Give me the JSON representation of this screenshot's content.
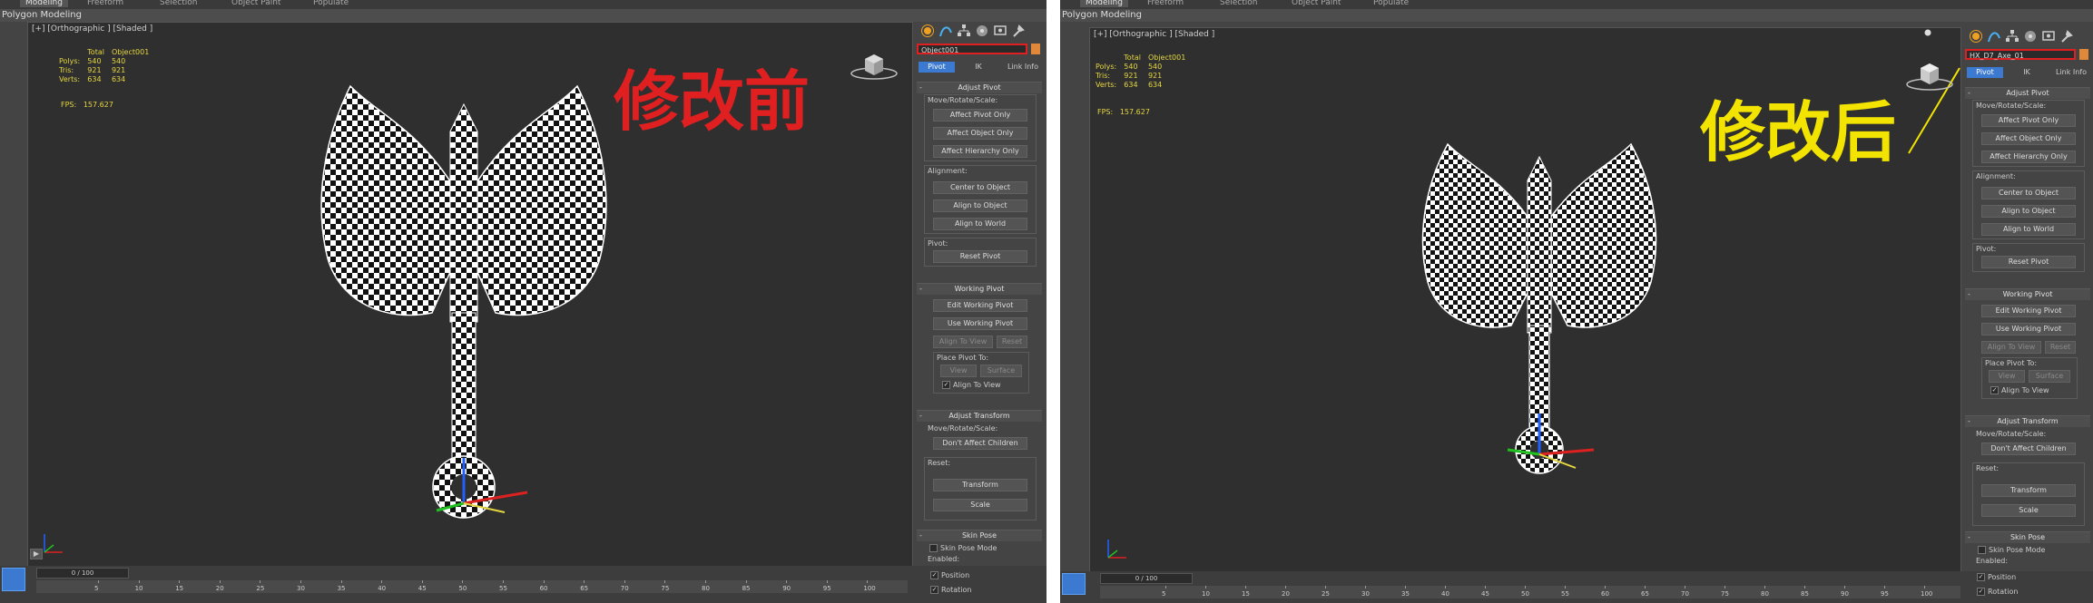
{
  "colors": {
    "accent_blue": "#3b7ad0",
    "highlight_red": "#e02020",
    "stats_yellow": "#e5d640",
    "before_text": "#e02020",
    "after_text": "#f2e400",
    "swatch_orange": "#e0883a"
  },
  "left": {
    "ribbon_tabs": [
      "Modeling",
      "Freeform",
      "Selection",
      "Object Paint",
      "Populate"
    ],
    "subtitle": "Polygon Modeling",
    "viewport_label": "[+] [Orthographic ] [Shaded ]",
    "stats": {
      "col_total": "Total",
      "col_object": "Object001",
      "rows": [
        {
          "label": "Polys:",
          "total": "540",
          "object": "540"
        },
        {
          "label": "Tris:",
          "total": "921",
          "object": "921"
        },
        {
          "label": "Verts:",
          "total": "634",
          "object": "634"
        }
      ]
    },
    "fps_label": "FPS:",
    "fps_value": "157.627",
    "annotation": "修改前",
    "object_name": "Object001",
    "time_slider": "0 / 100"
  },
  "right": {
    "ribbon_tabs": [
      "Modeling",
      "Freeform",
      "Selection",
      "Object Paint",
      "Populate"
    ],
    "subtitle": "Polygon Modeling",
    "viewport_label": "[+] [Orthographic ] [Shaded ]",
    "stats": {
      "col_total": "Total",
      "col_object": "Object001",
      "rows": [
        {
          "label": "Polys:",
          "total": "540",
          "object": "540"
        },
        {
          "label": "Tris:",
          "total": "921",
          "object": "921"
        },
        {
          "label": "Verts:",
          "total": "634",
          "object": "634"
        }
      ]
    },
    "fps_label": "FPS:",
    "fps_value": "157.627",
    "annotation": "修改后",
    "object_name": "HX_D7_Axe_01",
    "time_slider": "0 / 100"
  },
  "cmd": {
    "tabs": [
      "Pivot",
      "IK",
      "Link Info"
    ],
    "adjust_pivot": {
      "title": "Adjust Pivot",
      "move_label": "Move/Rotate/Scale:",
      "buttons": [
        "Affect Pivot Only",
        "Affect Object Only",
        "Affect Hierarchy Only"
      ],
      "alignment_label": "Alignment:",
      "align_buttons": [
        "Center to Object",
        "Align to Object",
        "Align to World"
      ],
      "pivot_label": "Pivot:",
      "reset_pivot": "Reset Pivot"
    },
    "working_pivot": {
      "title": "Working Pivot",
      "edit": "Edit Working Pivot",
      "use": "Use Working Pivot",
      "align_to_view": "Align To View",
      "reset": "Reset",
      "place_label": "Place Pivot To:",
      "view": "View",
      "surface": "Surface",
      "align_chk": "Align To View"
    },
    "adjust_transform": {
      "title": "Adjust Transform",
      "move_label": "Move/Rotate/Scale:",
      "dont_affect": "Don't Affect Children",
      "reset_label": "Reset:",
      "transform": "Transform",
      "scale": "Scale"
    },
    "skin_pose": {
      "title": "Skin Pose",
      "mode": "Skin Pose Mode",
      "enabled_label": "Enabled:",
      "position": "Position",
      "rotation": "Rotation"
    }
  },
  "ruler_ticks": [
    "5",
    "10",
    "15",
    "20",
    "25",
    "30",
    "35",
    "40",
    "45",
    "50",
    "55",
    "60",
    "65",
    "70",
    "75",
    "80",
    "85",
    "90",
    "95",
    "100"
  ],
  "icons": [
    "sun-icon",
    "curve-icon",
    "hierarchy-icon",
    "motion-icon",
    "display-icon",
    "utilities-icon"
  ]
}
